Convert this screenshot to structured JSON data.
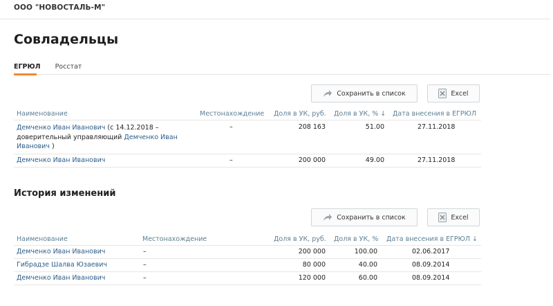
{
  "company": "ООО \"НОВОСТАЛЬ-М\"",
  "section": {
    "title": "Совладельцы"
  },
  "tabs": [
    {
      "label": "ЕГРЮЛ",
      "active": true
    },
    {
      "label": "Росстат",
      "active": false
    }
  ],
  "toolbar": {
    "save_label": "Сохранить в список",
    "excel_label": "Excel"
  },
  "owners_table": {
    "headers": {
      "name": "Наименование",
      "location": "Местонахождение",
      "share_rub": "Доля в УК, руб.",
      "share_pct": "Доля в УК, % ↓",
      "date": "Дата внесения в ЕГРЮЛ"
    },
    "rows": [
      {
        "name_prefix": "Демченко Иван Иванович",
        "name_mid": " (с 14.12.2018 –",
        "name_line2": "доверительный управляющий ",
        "trustee": "Демченко Иван",
        "trustee_line2": "Иванович",
        "name_suffix": " )",
        "location": "–",
        "share_rub": "208 163",
        "share_pct": "51.00",
        "date": "27.11.2018"
      },
      {
        "name": "Демченко Иван Иванович",
        "location": "–",
        "share_rub": "200 000",
        "share_pct": "49.00",
        "date": "27.11.2018"
      }
    ]
  },
  "history": {
    "title": "История изменений",
    "headers": {
      "name": "Наименование",
      "location": "Местонахождение",
      "share_rub": "Доля в УК, руб.",
      "share_pct": "Доля в УК, %",
      "date": "Дата внесения в ЕГРЮЛ ↓"
    },
    "rows": [
      {
        "name": "Демченко Иван Иванович",
        "location": "–",
        "share_rub": "200 000",
        "share_pct": "100.00",
        "date": "02.06.2017"
      },
      {
        "name": "Гибрадзе Шалва Юзаевич",
        "location": "–",
        "share_rub": "80 000",
        "share_pct": "40.00",
        "date": "08.09.2014"
      },
      {
        "name": "Демченко Иван Иванович",
        "location": "–",
        "share_rub": "120 000",
        "share_pct": "60.00",
        "date": "08.09.2014"
      }
    ]
  }
}
